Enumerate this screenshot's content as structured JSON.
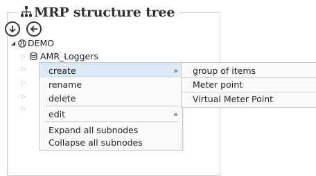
{
  "panel": {
    "title": "MRP structure tree",
    "buttons": [
      {
        "icon": "arrow-down-circle-icon"
      },
      {
        "icon": "arrow-left-circle-icon"
      }
    ]
  },
  "tree": {
    "root": {
      "label": "DEMO",
      "icon": "globe-icon",
      "expanded": true
    },
    "child": {
      "label": "AMR_Loggers",
      "icon": "database-icon",
      "expanded": false
    }
  },
  "context_menu": {
    "items": [
      {
        "label": "create",
        "has_submenu": true,
        "highlighted": true
      },
      {
        "label": "rename"
      },
      {
        "label": "delete"
      },
      {
        "label": "edit",
        "has_submenu": true
      },
      {
        "label": "Expand all subnodes"
      },
      {
        "label": "Collapse all subnodes"
      }
    ],
    "submenu_arrow": "»"
  },
  "submenu": {
    "items": [
      {
        "label": "group of items"
      },
      {
        "label": "Meter point"
      },
      {
        "label": "Virtual Meter Point"
      }
    ]
  }
}
